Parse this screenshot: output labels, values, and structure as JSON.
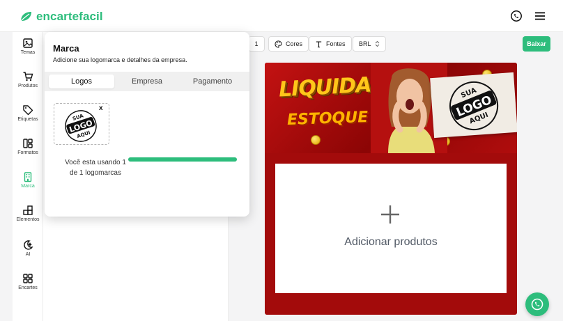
{
  "brand": {
    "name": "encartefacil",
    "color": "#2dbd7c"
  },
  "sidebar": {
    "items": [
      {
        "label": "Temas",
        "icon": "image-icon"
      },
      {
        "label": "Produtos",
        "icon": "cart-icon"
      },
      {
        "label": "Etiquetas",
        "icon": "tag-icon"
      },
      {
        "label": "Formatos",
        "icon": "layout-icon"
      },
      {
        "label": "Marca",
        "icon": "building-icon",
        "active": true
      },
      {
        "label": "Elementos",
        "icon": "shapes-icon"
      },
      {
        "label": "AI",
        "icon": "ai-icon"
      },
      {
        "label": "Encartes",
        "icon": "grid-icon"
      }
    ]
  },
  "toolbar": {
    "pages": "1",
    "colors_label": "Cores",
    "fonts_label": "Fontes",
    "currency": "BRL",
    "download_label": "Baixar"
  },
  "popup": {
    "title": "Marca",
    "subtitle": "Adicione sua logomarca e detalhes da empresa.",
    "tabs": [
      "Logos",
      "Empresa",
      "Pagamento"
    ],
    "active_tab": "Logos",
    "close_symbol": "x",
    "usage_line1": "Você esta usando 1",
    "usage_line2": "de 1 logomarcas",
    "usage_fraction": 1.0
  },
  "flyer": {
    "headline_top": "LIQUIDA",
    "headline_bottom": "ESTOQUE",
    "logo_text": [
      "SUA",
      "LOGO",
      "AQUI"
    ],
    "add_products_label": "Adicionar produtos"
  }
}
